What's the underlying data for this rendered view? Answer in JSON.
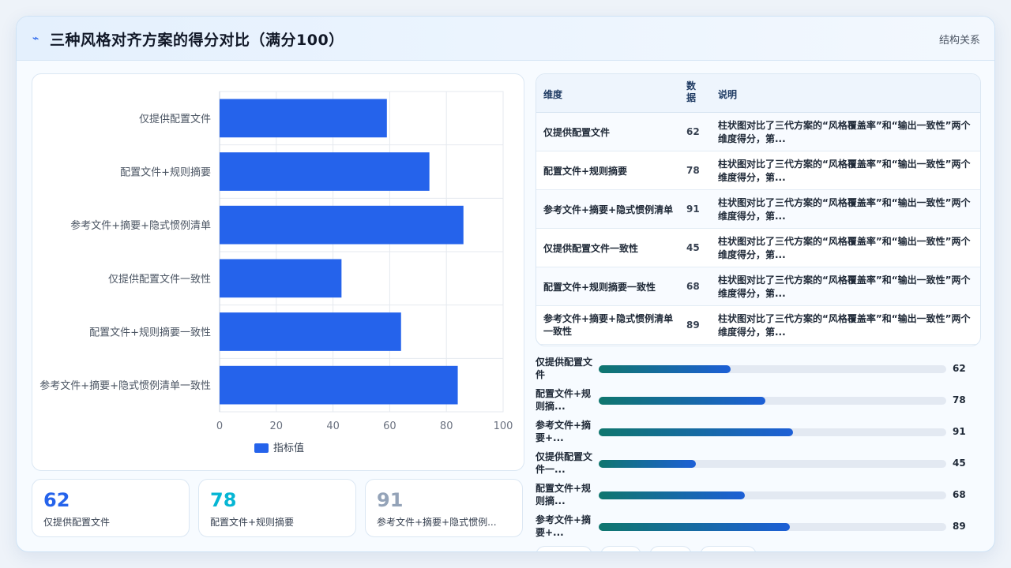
{
  "header": {
    "title": "三种风格对齐方案的得分对比（满分100）",
    "right_link": "结构关系",
    "logo_icon": "spark-icon"
  },
  "chart_data": {
    "type": "bar",
    "orientation": "horizontal",
    "categories": [
      "仅提供配置文件",
      "配置文件+规则摘要",
      "参考文件+摘要+隐式惯例清单",
      "仅提供配置文件一致性",
      "配置文件+规则摘要一致性",
      "参考文件+摘要+隐式惯例清单一致性"
    ],
    "series": [
      {
        "name": "指标值",
        "values": [
          59,
          74,
          86,
          43,
          64,
          84
        ],
        "color": "#2563eb"
      }
    ],
    "xlim": [
      0,
      100
    ],
    "xticks": [
      "0",
      "20",
      "40",
      "60",
      "80",
      "100"
    ],
    "grid": true,
    "legend": "bottom"
  },
  "kpis": [
    {
      "value": "62",
      "label": "仅提供配置文件",
      "color": "#2563eb"
    },
    {
      "value": "78",
      "label": "配置文件+规则摘要",
      "color": "#06b6d4"
    },
    {
      "value": "91",
      "label": "参考文件+摘要+隐式惯例...",
      "color": "#94a3b8"
    }
  ],
  "table": {
    "headers": [
      "维度",
      "数据",
      "说明"
    ],
    "rows": [
      {
        "dim": "仅提供配置文件",
        "value": "62",
        "desc": "柱状图对比了三代方案的“风格覆盖率”和“输出一致性”两个维度得分，第..."
      },
      {
        "dim": "配置文件+规则摘要",
        "value": "78",
        "desc": "柱状图对比了三代方案的“风格覆盖率”和“输出一致性”两个维度得分，第..."
      },
      {
        "dim": "参考文件+摘要+隐式惯例清单",
        "value": "91",
        "desc": "柱状图对比了三代方案的“风格覆盖率”和“输出一致性”两个维度得分，第..."
      },
      {
        "dim": "仅提供配置文件一致性",
        "value": "45",
        "desc": "柱状图对比了三代方案的“风格覆盖率”和“输出一致性”两个维度得分，第..."
      },
      {
        "dim": "配置文件+规则摘要一致性",
        "value": "68",
        "desc": "柱状图对比了三代方案的“风格覆盖率”和“输出一致性”两个维度得分，第..."
      },
      {
        "dim": "参考文件+摘要+隐式惯例清单一致性",
        "value": "89",
        "desc": "柱状图对比了三代方案的“风格覆盖率”和“输出一致性”两个维度得分，第..."
      }
    ]
  },
  "progress": [
    {
      "label": "仅提供配置文件",
      "value": "62",
      "fraction": 0.38
    },
    {
      "label": "配置文件+规则摘...",
      "value": "78",
      "fraction": 0.48
    },
    {
      "label": "参考文件+摘要+...",
      "value": "91",
      "fraction": 0.56
    },
    {
      "label": "仅提供配置文件一...",
      "value": "45",
      "fraction": 0.28
    },
    {
      "label": "配置文件+规则摘...",
      "value": "68",
      "fraction": 0.42
    },
    {
      "label": "参考文件+摘要+...",
      "value": "89",
      "fraction": 0.55
    }
  ]
}
